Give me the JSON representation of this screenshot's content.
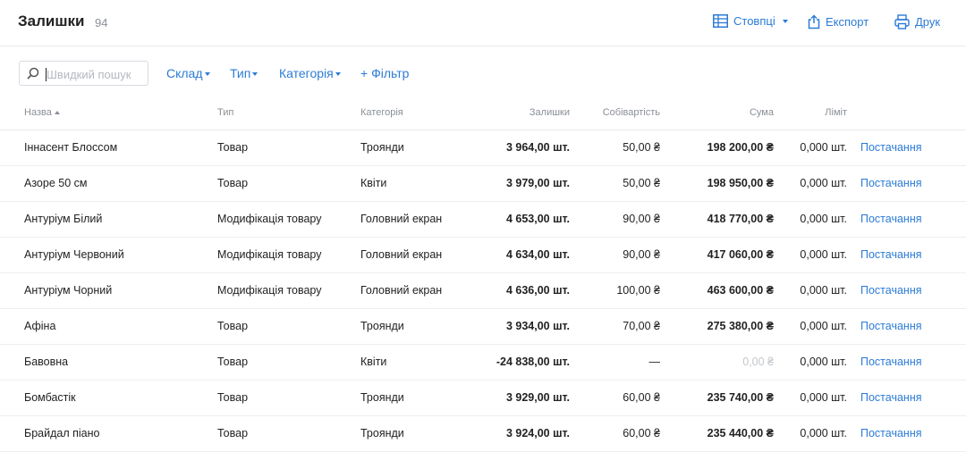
{
  "header": {
    "title": "Залишки",
    "count": "94",
    "columns_label": "Стовпці",
    "export_label": "Експорт",
    "print_label": "Друк"
  },
  "filters": {
    "search_placeholder": "Швидкий пошук",
    "warehouse_label": "Склад",
    "type_label": "Тип",
    "category_label": "Категорія",
    "add_filter_label": "+ Фільтр"
  },
  "table": {
    "columns": {
      "name": "Назва",
      "type": "Тип",
      "category": "Категорія",
      "qty": "Залишки",
      "cost": "Собівартість",
      "sum": "Сума",
      "limit": "Ліміт"
    },
    "action_label": "Постачання",
    "rows": [
      {
        "name": "Іннасент Блоссом",
        "type": "Товар",
        "category": "Троянди",
        "qty": "3 964,00 шт.",
        "cost": "50,00 ₴",
        "sum": "198 200,00 ₴",
        "limit": "0,000 шт."
      },
      {
        "name": "Азоре 50 см",
        "type": "Товар",
        "category": "Квіти",
        "qty": "3 979,00 шт.",
        "cost": "50,00 ₴",
        "sum": "198 950,00 ₴",
        "limit": "0,000 шт."
      },
      {
        "name": "Антуріум Білий",
        "type": "Модифікація товару",
        "category": "Головний екран",
        "qty": "4 653,00 шт.",
        "cost": "90,00 ₴",
        "sum": "418 770,00 ₴",
        "limit": "0,000 шт."
      },
      {
        "name": "Антуріум Червоний",
        "type": "Модифікація товару",
        "category": "Головний екран",
        "qty": "4 634,00 шт.",
        "cost": "90,00 ₴",
        "sum": "417 060,00 ₴",
        "limit": "0,000 шт."
      },
      {
        "name": "Антуріум Чорний",
        "type": "Модифікація товару",
        "category": "Головний екран",
        "qty": "4 636,00 шт.",
        "cost": "100,00 ₴",
        "sum": "463 600,00 ₴",
        "limit": "0,000 шт."
      },
      {
        "name": "Афіна",
        "type": "Товар",
        "category": "Троянди",
        "qty": "3 934,00 шт.",
        "cost": "70,00 ₴",
        "sum": "275 380,00 ₴",
        "limit": "0,000 шт."
      },
      {
        "name": "Бавовна",
        "type": "Товар",
        "category": "Квіти",
        "qty": "-24 838,00 шт.",
        "cost": "—",
        "sum": "0,00 ₴",
        "sum_muted": true,
        "limit": "0,000 шт."
      },
      {
        "name": "Бомбастік",
        "type": "Товар",
        "category": "Троянди",
        "qty": "3 929,00 шт.",
        "cost": "60,00 ₴",
        "sum": "235 740,00 ₴",
        "limit": "0,000 шт."
      },
      {
        "name": "Брайдал піано",
        "type": "Товар",
        "category": "Троянди",
        "qty": "3 924,00 шт.",
        "cost": "60,00 ₴",
        "sum": "235 440,00 ₴",
        "limit": "0,000 шт."
      }
    ]
  },
  "colors": {
    "accent": "#2b7bd6",
    "muted_text": "#8a8f96",
    "divider": "#e6e8eb"
  },
  "icons": {
    "columns": "table-icon",
    "export": "upload-icon",
    "print": "printer-icon",
    "search": "search-icon"
  }
}
